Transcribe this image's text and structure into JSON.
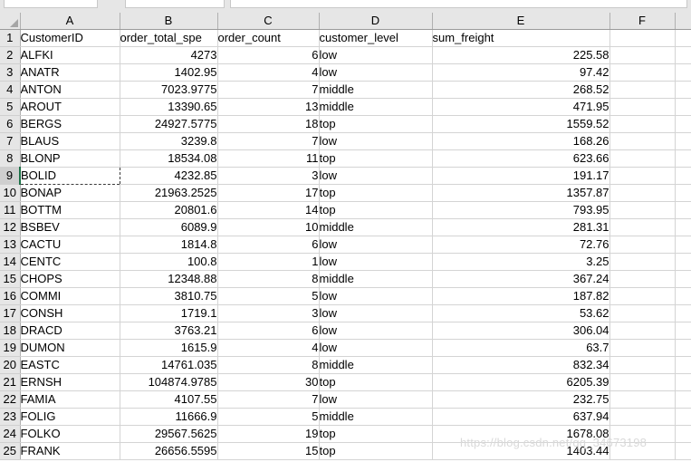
{
  "app": {
    "type": "spreadsheet",
    "corner_icon": "select-all-triangle-icon"
  },
  "formula_bar": {
    "name_box_value": "",
    "formula_value": ""
  },
  "grid": {
    "column_headers": [
      "A",
      "B",
      "C",
      "D",
      "E",
      "F"
    ],
    "row_numbers": [
      "1",
      "2",
      "3",
      "4",
      "5",
      "6",
      "7",
      "8",
      "9",
      "10",
      "11",
      "12",
      "13",
      "14",
      "15",
      "16",
      "17",
      "18",
      "19",
      "20",
      "21",
      "22",
      "23",
      "24",
      "25"
    ],
    "active_row": "9",
    "active_cell": "A9",
    "headers": {
      "A": "CustomerID",
      "B": "order_total_spe",
      "C": "order_count",
      "D": "customer_level",
      "E": "sum_freight",
      "F": ""
    },
    "rows": [
      {
        "row": "2",
        "A": "ALFKI",
        "B": "4273",
        "C": "6",
        "D": "low",
        "E": "225.58",
        "F": ""
      },
      {
        "row": "3",
        "A": "ANATR",
        "B": "1402.95",
        "C": "4",
        "D": "low",
        "E": "97.42",
        "F": ""
      },
      {
        "row": "4",
        "A": "ANTON",
        "B": "7023.9775",
        "C": "7",
        "D": "middle",
        "E": "268.52",
        "F": ""
      },
      {
        "row": "5",
        "A": "AROUT",
        "B": "13390.65",
        "C": "13",
        "D": "middle",
        "E": "471.95",
        "F": ""
      },
      {
        "row": "6",
        "A": "BERGS",
        "B": "24927.5775",
        "C": "18",
        "D": "top",
        "E": "1559.52",
        "F": ""
      },
      {
        "row": "7",
        "A": "BLAUS",
        "B": "3239.8",
        "C": "7",
        "D": "low",
        "E": "168.26",
        "F": ""
      },
      {
        "row": "8",
        "A": "BLONP",
        "B": "18534.08",
        "C": "11",
        "D": "top",
        "E": "623.66",
        "F": ""
      },
      {
        "row": "9",
        "A": "BOLID",
        "B": "4232.85",
        "C": "3",
        "D": "low",
        "E": "191.17",
        "F": ""
      },
      {
        "row": "10",
        "A": "BONAP",
        "B": "21963.2525",
        "C": "17",
        "D": "top",
        "E": "1357.87",
        "F": ""
      },
      {
        "row": "11",
        "A": "BOTTM",
        "B": "20801.6",
        "C": "14",
        "D": "top",
        "E": "793.95",
        "F": ""
      },
      {
        "row": "12",
        "A": "BSBEV",
        "B": "6089.9",
        "C": "10",
        "D": "middle",
        "E": "281.31",
        "F": ""
      },
      {
        "row": "13",
        "A": "CACTU",
        "B": "1814.8",
        "C": "6",
        "D": "low",
        "E": "72.76",
        "F": ""
      },
      {
        "row": "14",
        "A": "CENTC",
        "B": "100.8",
        "C": "1",
        "D": "low",
        "E": "3.25",
        "F": ""
      },
      {
        "row": "15",
        "A": "CHOPS",
        "B": "12348.88",
        "C": "8",
        "D": "middle",
        "E": "367.24",
        "F": ""
      },
      {
        "row": "16",
        "A": "COMMI",
        "B": "3810.75",
        "C": "5",
        "D": "low",
        "E": "187.82",
        "F": ""
      },
      {
        "row": "17",
        "A": "CONSH",
        "B": "1719.1",
        "C": "3",
        "D": "low",
        "E": "53.62",
        "F": ""
      },
      {
        "row": "18",
        "A": "DRACD",
        "B": "3763.21",
        "C": "6",
        "D": "low",
        "E": "306.04",
        "F": ""
      },
      {
        "row": "19",
        "A": "DUMON",
        "B": "1615.9",
        "C": "4",
        "D": "low",
        "E": "63.7",
        "F": ""
      },
      {
        "row": "20",
        "A": "EASTC",
        "B": "14761.035",
        "C": "8",
        "D": "middle",
        "E": "832.34",
        "F": ""
      },
      {
        "row": "21",
        "A": "ERNSH",
        "B": "104874.9785",
        "C": "30",
        "D": "top",
        "E": "6205.39",
        "F": ""
      },
      {
        "row": "22",
        "A": "FAMIA",
        "B": "4107.55",
        "C": "7",
        "D": "low",
        "E": "232.75",
        "F": ""
      },
      {
        "row": "23",
        "A": "FOLIG",
        "B": "11666.9",
        "C": "5",
        "D": "middle",
        "E": "637.94",
        "F": ""
      },
      {
        "row": "24",
        "A": "FOLKO",
        "B": "29567.5625",
        "C": "19",
        "D": "top",
        "E": "1678.08",
        "F": ""
      },
      {
        "row": "25",
        "A": "FRANK",
        "B": "26656.5595",
        "C": "15",
        "D": "top",
        "E": "1403.44",
        "F": ""
      }
    ]
  },
  "watermark": {
    "text": "https://blog.csdn.net/qq_34673198"
  },
  "colors": {
    "header_background": "#e6e6e6",
    "grid_line": "#d4d4d4",
    "active_row_header": "#cfcfcf",
    "active_accent": "#1a7045",
    "watermark": "#d9d9d9",
    "cell_background": "#ffffff"
  }
}
